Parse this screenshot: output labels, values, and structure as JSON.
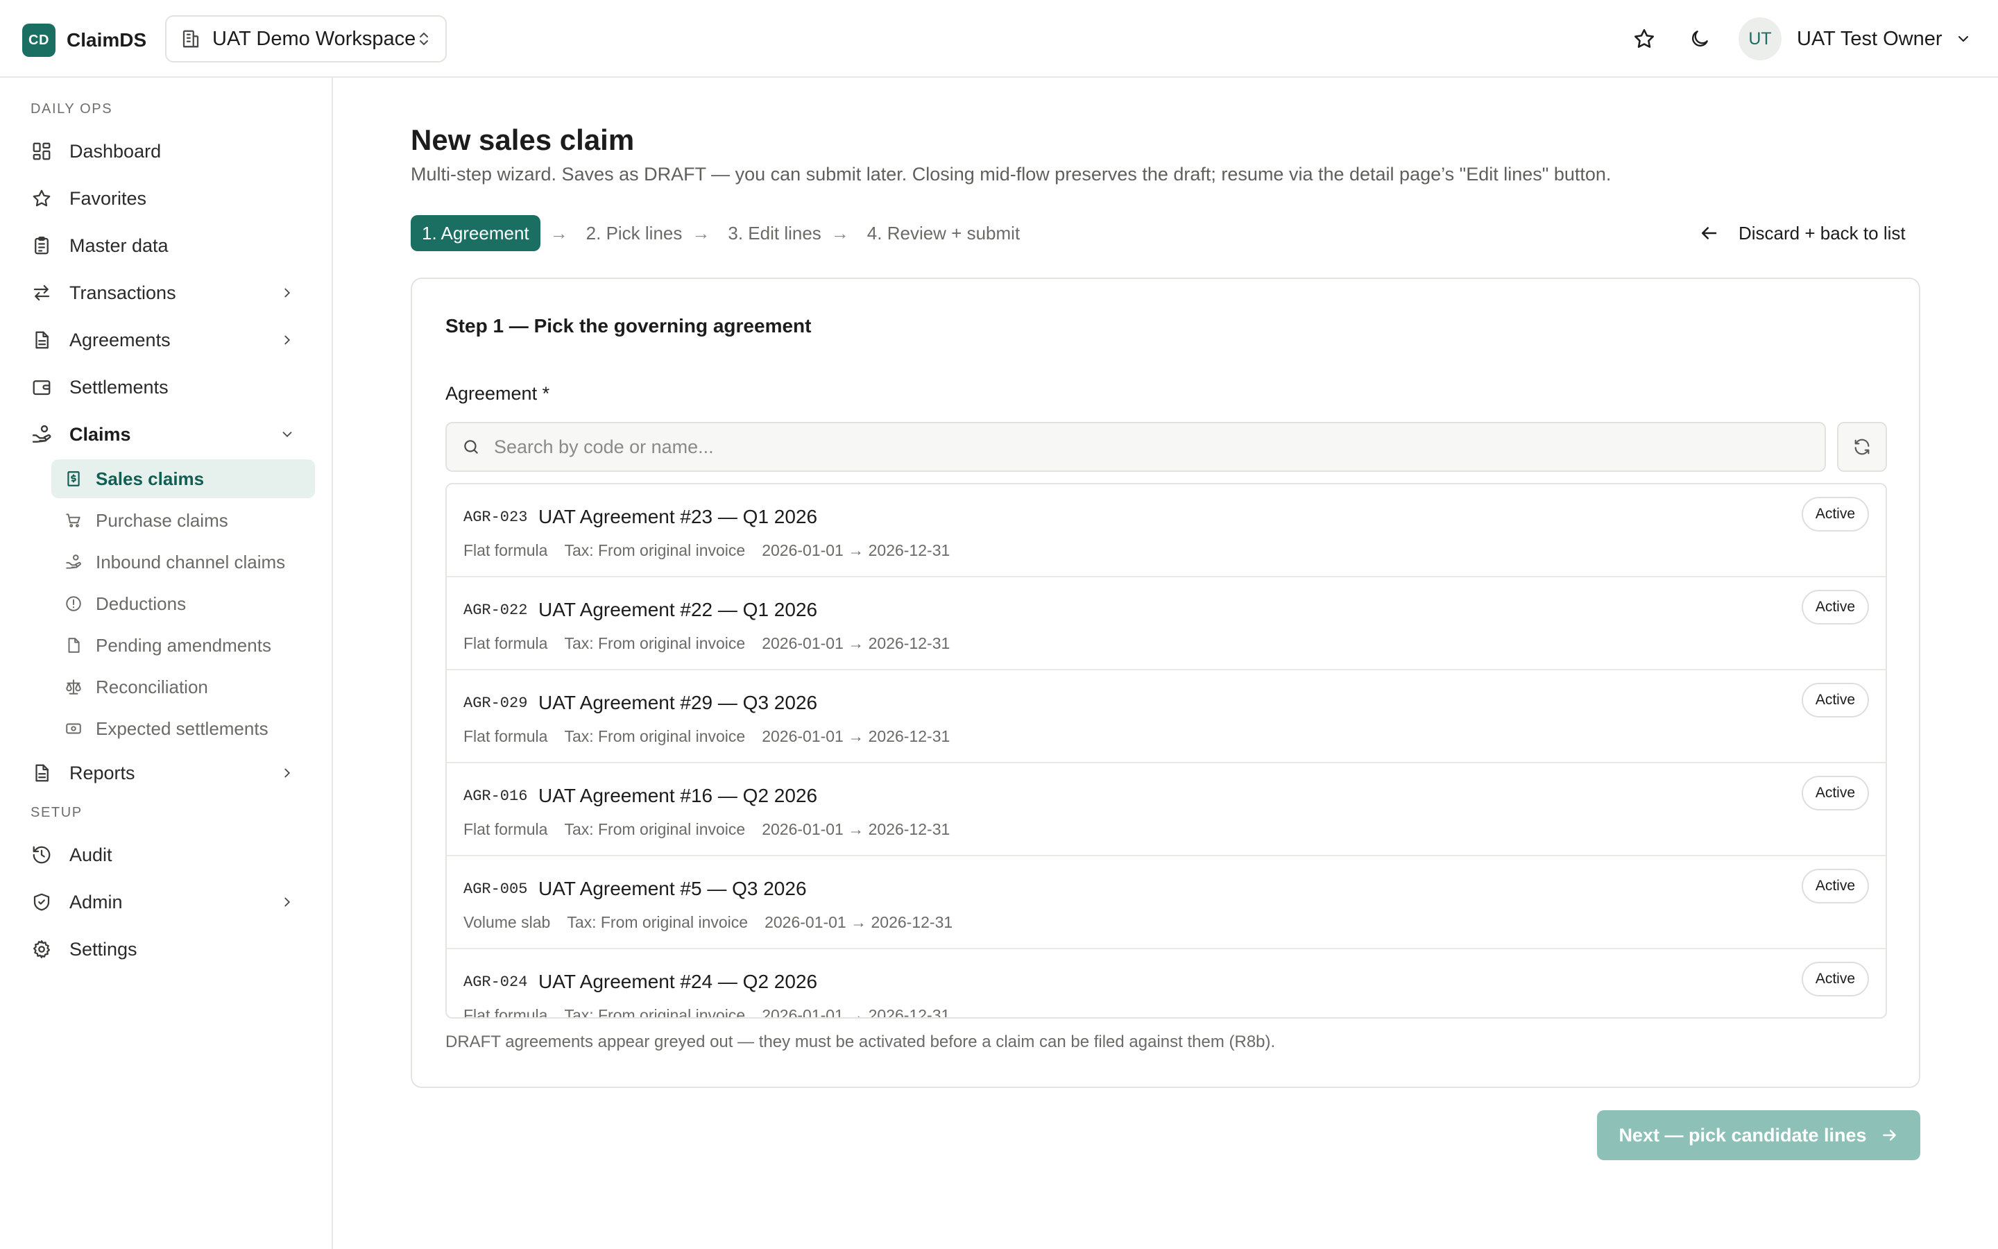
{
  "app": {
    "logo": "CD",
    "name": "ClaimDS"
  },
  "workspace": {
    "label": "UAT Demo Workspace"
  },
  "user": {
    "initials": "UT",
    "name": "UAT Test Owner"
  },
  "sidebar": {
    "sections": {
      "daily_ops": "DAILY OPS",
      "setup": "SETUP"
    },
    "items": {
      "dashboard": "Dashboard",
      "favorites": "Favorites",
      "master_data": "Master data",
      "transactions": "Transactions",
      "agreements": "Agreements",
      "settlements": "Settlements",
      "claims": "Claims",
      "reports": "Reports",
      "audit": "Audit",
      "admin": "Admin",
      "settings": "Settings"
    },
    "claims_sub": {
      "sales": "Sales claims",
      "purchase": "Purchase claims",
      "inbound": "Inbound channel claims",
      "deductions": "Deductions",
      "pending": "Pending amendments",
      "reconciliation": "Reconciliation",
      "expected": "Expected settlements"
    }
  },
  "page": {
    "title": "New sales claim",
    "subtitle": "Multi-step wizard. Saves as DRAFT — you can submit later. Closing mid-flow preserves the draft; resume via the detail page’s \"Edit lines\" button.",
    "steps": [
      "1. Agreement",
      "2. Pick lines",
      "3. Edit lines",
      "4. Review + submit"
    ],
    "step_arrow": "→",
    "discard_label": "Discard + back to list"
  },
  "card": {
    "title": "Step 1 — Pick the governing agreement",
    "field_label": "Agreement *",
    "search_placeholder": "Search by code or name...",
    "note": "DRAFT agreements appear greyed out — they must be activated before a claim can be filed against them (R8b).",
    "agreements": [
      {
        "code": "AGR-023",
        "name": "UAT Agreement #23 — Q1 2026",
        "formula": "Flat formula",
        "tax": "Tax: From original invoice",
        "period": "2026-01-01 → 2026-12-31",
        "status": "Active"
      },
      {
        "code": "AGR-022",
        "name": "UAT Agreement #22 — Q1 2026",
        "formula": "Flat formula",
        "tax": "Tax: From original invoice",
        "period": "2026-01-01 → 2026-12-31",
        "status": "Active"
      },
      {
        "code": "AGR-029",
        "name": "UAT Agreement #29 — Q3 2026",
        "formula": "Flat formula",
        "tax": "Tax: From original invoice",
        "period": "2026-01-01 → 2026-12-31",
        "status": "Active"
      },
      {
        "code": "AGR-016",
        "name": "UAT Agreement #16 — Q2 2026",
        "formula": "Flat formula",
        "tax": "Tax: From original invoice",
        "period": "2026-01-01 → 2026-12-31",
        "status": "Active"
      },
      {
        "code": "AGR-005",
        "name": "UAT Agreement #5 — Q3 2026",
        "formula": "Volume slab",
        "tax": "Tax: From original invoice",
        "period": "2026-01-01 → 2026-12-31",
        "status": "Active"
      },
      {
        "code": "AGR-024",
        "name": "UAT Agreement #24 — Q2 2026",
        "formula": "Flat formula",
        "tax": "Tax: From original invoice",
        "period": "2026-01-01 → 2026-12-31",
        "status": "Active"
      }
    ]
  },
  "next_button": {
    "label": "Next — pick candidate lines"
  },
  "colors": {
    "brand": "#1a6e62",
    "active_nav_bg": "#e6f1ee",
    "disabled_primary": "#8dc1b7"
  }
}
